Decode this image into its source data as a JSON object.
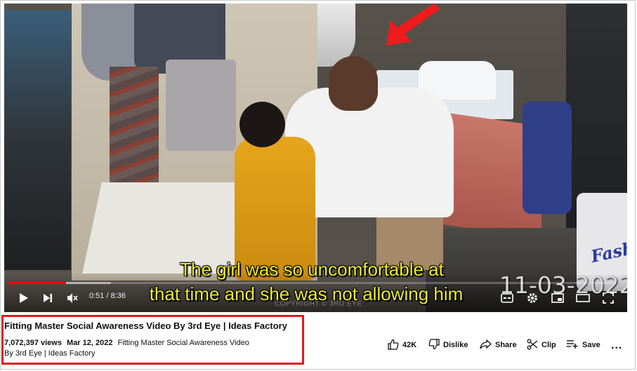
{
  "video": {
    "caption_line1": "The girl was so uncomfortable at",
    "caption_line2": "that time and she was not allowing him",
    "cctv_date": "11-03-2022",
    "watermark": "COPYRIGHT © 3RD EYE",
    "bag_text": "Fash",
    "progress_fraction": 0.096,
    "buffer_fraction": 0.17,
    "progress_color": "#ff0000",
    "caption_color": "#ecec2e"
  },
  "controls": {
    "time": "0:51 / 8:36",
    "icons": [
      "play-icon",
      "next-icon",
      "mute-icon",
      "subtitles-icon",
      "settings-icon",
      "miniplayer-icon",
      "theater-icon",
      "fullscreen-icon"
    ]
  },
  "info": {
    "title": "Fitting Master Social Awareness Video By 3rd Eye | Ideas Factory",
    "views": "7,072,397 views",
    "date": "Mar 12, 2022",
    "description": "Fitting Master Social Awareness Video",
    "channel_line": "By 3rd Eye | Ideas Factory",
    "highlight_color": "#e11b1b"
  },
  "actions": {
    "like_count": "42K",
    "dislike_label": "Dislike",
    "share_label": "Share",
    "clip_label": "Clip",
    "save_label": "Save",
    "more_label": "..."
  }
}
